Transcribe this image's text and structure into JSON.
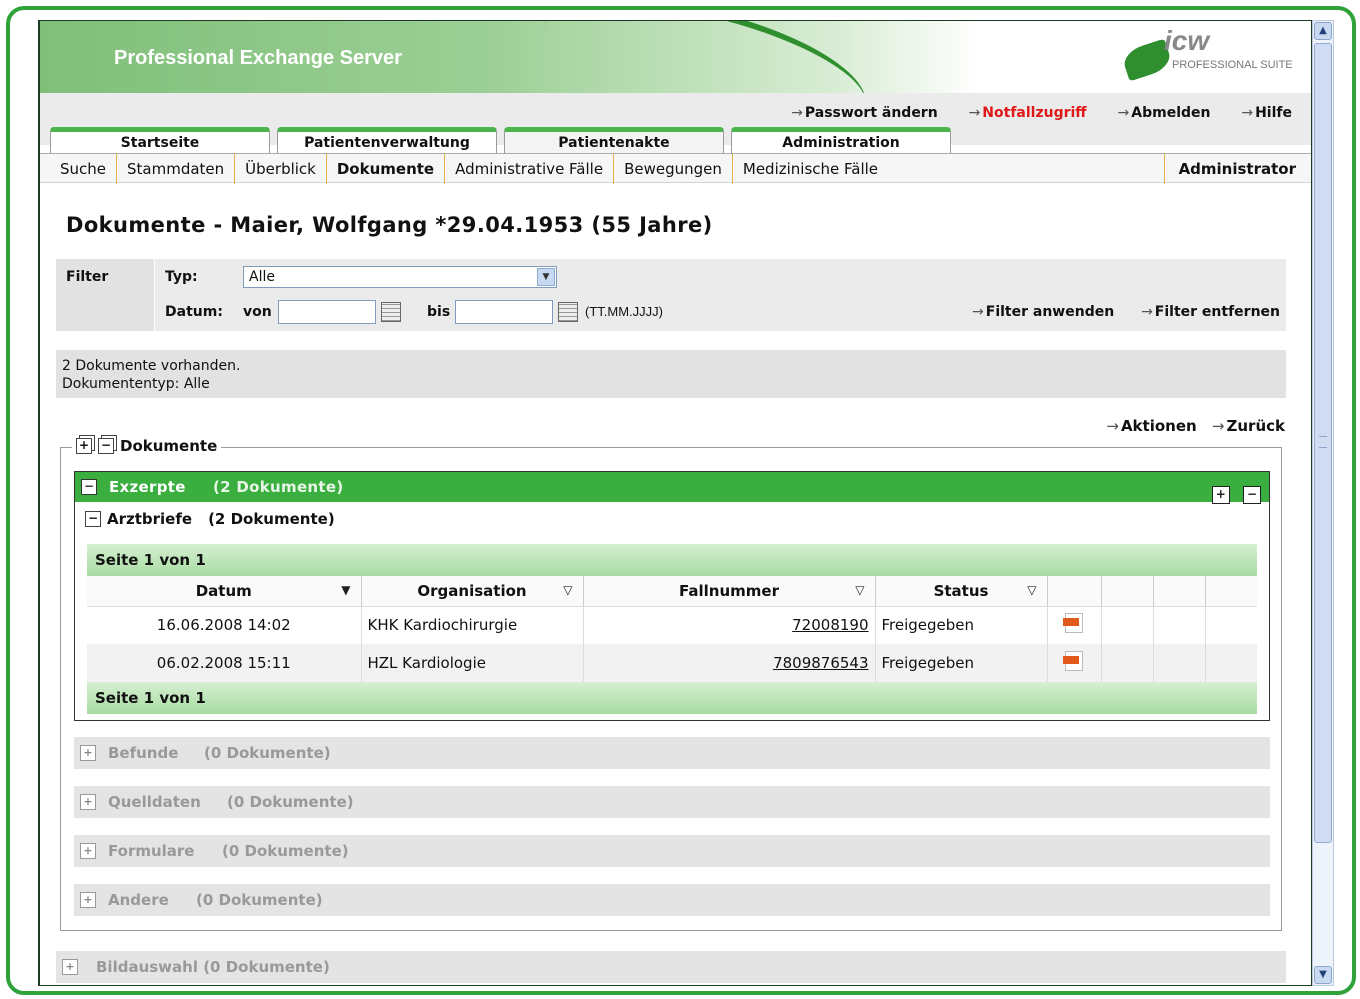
{
  "app": {
    "title": "Professional Exchange Server",
    "logo_text": "icw",
    "logo_sub": "PROFESSIONAL SUITE"
  },
  "toplinks": [
    "Passwort ändern",
    "Notfallzugriff",
    "Abmelden",
    "Hilfe"
  ],
  "tabs": [
    "Startseite",
    "Patientenverwaltung",
    "Patientenakte",
    "Administration"
  ],
  "active_tab": "Patientenakte",
  "subnav": [
    "Suche",
    "Stammdaten",
    "Überblick",
    "Dokumente",
    "Administrative Fälle",
    "Bewegungen",
    "Medizinische Fälle"
  ],
  "subnav_current": "Dokumente",
  "user": "Administrator",
  "page_title": "Dokumente - Maier, Wolfgang *29.04.1953 (55 Jahre)",
  "filter": {
    "label": "Filter",
    "typ_label": "Typ:",
    "typ_value": "Alle",
    "datum_label": "Datum:",
    "von_label": "von",
    "bis_label": "bis",
    "format_hint": "(TT.MM.JJJJ)",
    "apply": "Filter anwenden",
    "remove": "Filter entfernen"
  },
  "info": {
    "line1": "2 Dokumente vorhanden.",
    "line2": "Dokumententyp: Alle"
  },
  "actions": [
    "Aktionen",
    "Zurück"
  ],
  "legend": "Dokumente",
  "groups": {
    "exzerpte": {
      "name": "Exzerpte",
      "count": "(2 Dokumente)"
    },
    "arztbriefe": {
      "name": "Arztbriefe",
      "count": "(2 Dokumente)"
    }
  },
  "pager": "Seite 1 von 1",
  "columns": [
    "Datum",
    "Organisation",
    "Fallnummer",
    "Status"
  ],
  "rows": [
    {
      "datum": "16.06.2008 14:02",
      "organisation": "KHK Kardiochirurgie",
      "fallnummer": "72008190",
      "status": "Freigegeben"
    },
    {
      "datum": "06.02.2008 15:11",
      "organisation": "HZL Kardiologie",
      "fallnummer": "7809876543",
      "status": "Freigegeben"
    }
  ],
  "collapsed": [
    {
      "name": "Befunde",
      "count": "(0 Dokumente)"
    },
    {
      "name": "Quelldaten",
      "count": "(0 Dokumente)"
    },
    {
      "name": "Formulare",
      "count": "(0 Dokumente)"
    },
    {
      "name": "Andere",
      "count": "(0 Dokumente)"
    }
  ],
  "bildauswahl": "Bildauswahl (0 Dokumente)",
  "colors": {
    "accent_green": "#3aae3e",
    "frame_green": "#2fa23a",
    "alert_red": "#e01818"
  }
}
